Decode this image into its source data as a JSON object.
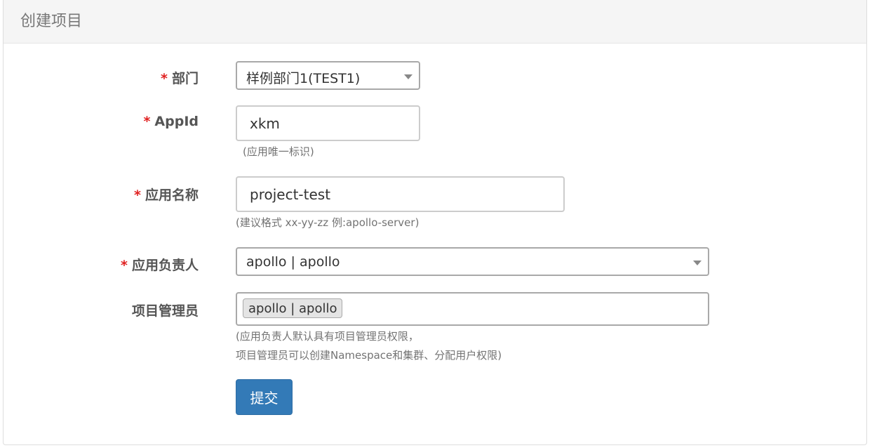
{
  "panel": {
    "title": "创建项目"
  },
  "form": {
    "department": {
      "required_mark": "*",
      "label": "部门",
      "value": "样例部门1(TEST1)"
    },
    "app_id": {
      "required_mark": "*",
      "label": "AppId",
      "value": "xkm",
      "help": "(应用唯一标识)"
    },
    "app_name": {
      "required_mark": "*",
      "label": "应用名称",
      "value": "project-test",
      "help": "(建议格式 xx-yy-zz 例:apollo-server)"
    },
    "owner": {
      "required_mark": "*",
      "label": "应用负责人",
      "value": "apollo | apollo"
    },
    "admins": {
      "label": "项目管理员",
      "tags": [
        "apollo | apollo"
      ],
      "help_line1": "(应用负责人默认具有项目管理员权限，",
      "help_line2": "项目管理员可以创建Namespace和集群、分配用户权限)"
    },
    "submit_label": "提交"
  },
  "colors": {
    "primary": "#337ab7",
    "required": "#e02020",
    "heading_bg": "#f5f5f5"
  }
}
